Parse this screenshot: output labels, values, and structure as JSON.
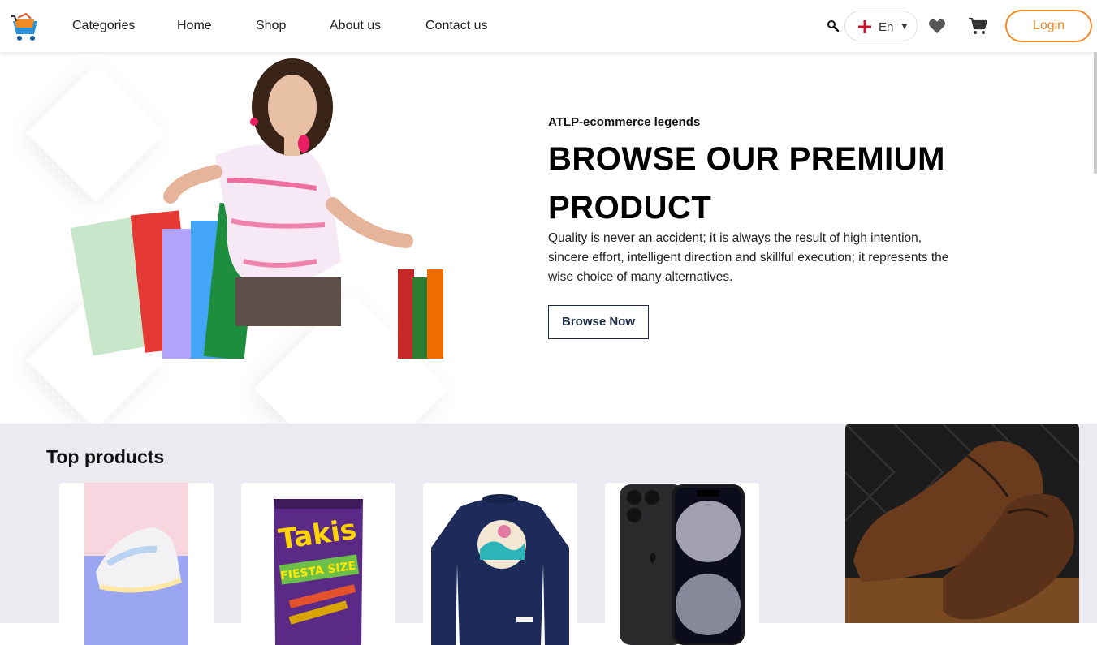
{
  "nav": {
    "links": [
      {
        "label": "Categories"
      },
      {
        "label": "Home"
      },
      {
        "label": "Shop"
      },
      {
        "label": "About us"
      },
      {
        "label": "Contact us"
      }
    ],
    "language": "En",
    "login_label": "Login"
  },
  "hero": {
    "eyebrow": "ATLP-ecommerce legends",
    "headline": "BROWSE OUR PREMIUM PRODUCT",
    "description": "Quality is never an accident; it is always the result of high intention, sincere effort, intelligent direction and skillful execution; it represents the wise choice of many alternatives.",
    "cta_label": "Browse Now"
  },
  "products": {
    "title": "Top products",
    "items": [
      {
        "icon": "sneaker-image"
      },
      {
        "icon": "takis-snack-image"
      },
      {
        "icon": "sweatshirt-image"
      },
      {
        "icon": "smartphone-image"
      }
    ]
  },
  "colors": {
    "accent": "#f08a24",
    "section_bg": "#ebeaf0",
    "button_border": "#1b2a45"
  }
}
